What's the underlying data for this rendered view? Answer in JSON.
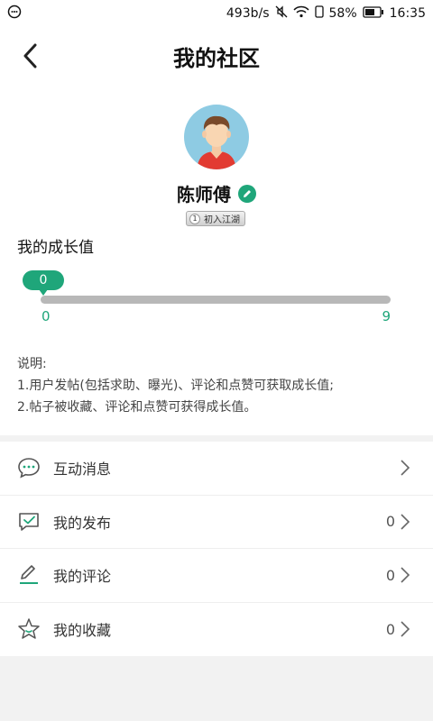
{
  "status_bar": {
    "speed": "493b/s",
    "battery": "58%",
    "time": "16:35"
  },
  "header": {
    "title": "我的社区"
  },
  "profile": {
    "name": "陈师傅",
    "level_number": "1",
    "level_name": "初入江湖"
  },
  "growth": {
    "title": "我的成长值",
    "current_value": "0",
    "min": "0",
    "max": "9",
    "progress_fraction": 0
  },
  "notes": {
    "heading": "说明:",
    "line1": "1.用户发帖(包括求助、曝光)、评论和点赞可获取成长值;",
    "line2": "2.帖子被收藏、评论和点赞可获得成长值。"
  },
  "menu": {
    "items": [
      {
        "label": "互动消息",
        "icon": "chat-bubble-icon",
        "count": ""
      },
      {
        "label": "我的发布",
        "icon": "check-message-icon",
        "count": "0"
      },
      {
        "label": "我的评论",
        "icon": "pencil-icon",
        "count": "0"
      },
      {
        "label": "我的收藏",
        "icon": "star-icon",
        "count": "0"
      }
    ]
  },
  "colors": {
    "accent": "#1fa67a",
    "track": "#b8b8b8",
    "background": "#f2f2f2"
  }
}
